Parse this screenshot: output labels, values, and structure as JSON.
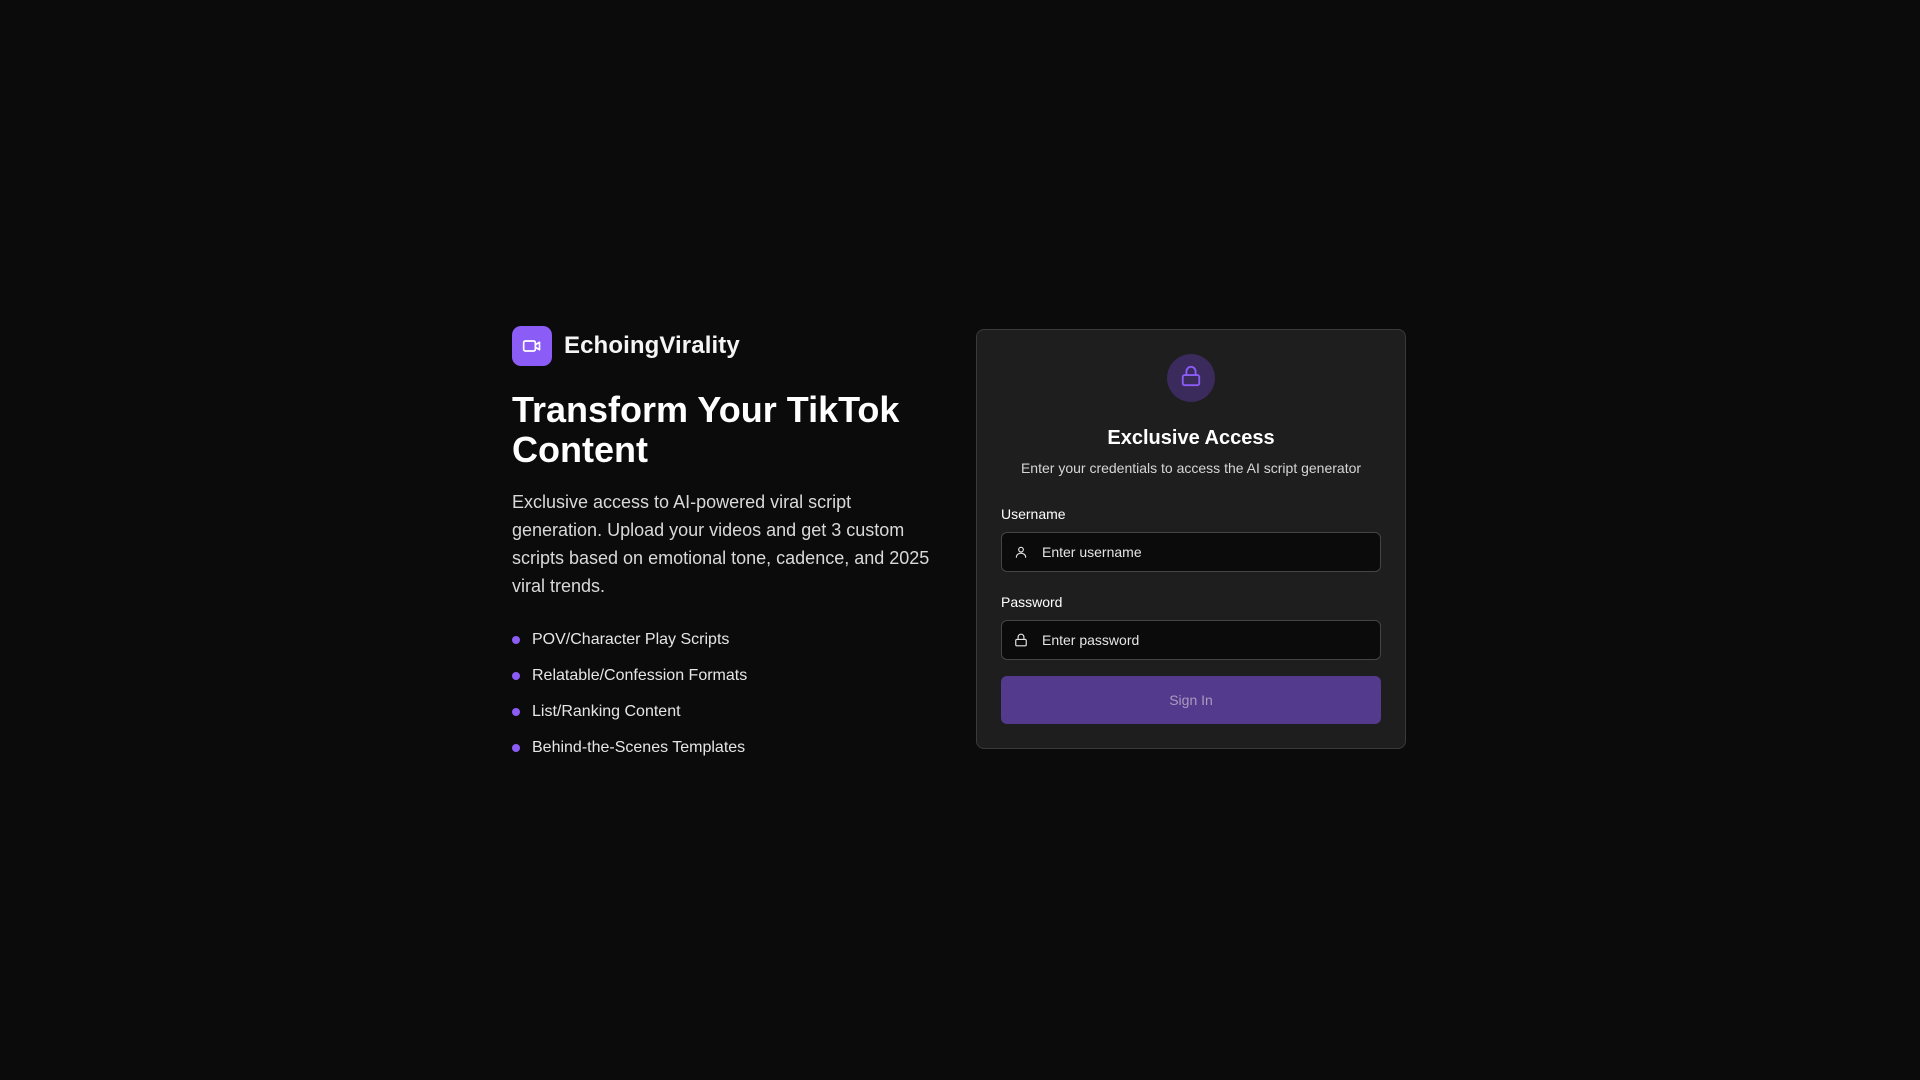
{
  "brand": {
    "name": "EchoingVirality",
    "logo_icon": "video-camera-icon",
    "accent_color": "#8b5cf6"
  },
  "hero": {
    "headline": "Transform Your TikTok Content",
    "description": "Exclusive access to AI-powered viral script generation. Upload your videos and get 3 custom scripts based on emotional tone, cadence, and 2025 viral trends.",
    "features": [
      "POV/Character Play Scripts",
      "Relatable/Confession Formats",
      "List/Ranking Content",
      "Behind-the-Scenes Templates"
    ]
  },
  "login": {
    "badge_icon": "lock-icon",
    "title": "Exclusive Access",
    "subtitle": "Enter your credentials to access the AI script generator",
    "username": {
      "label": "Username",
      "placeholder": "Enter username",
      "value": "",
      "icon": "user-icon"
    },
    "password": {
      "label": "Password",
      "placeholder": "Enter password",
      "value": "",
      "icon": "lock-icon"
    },
    "submit_label": "Sign In",
    "submit_color": "#533a8c"
  }
}
